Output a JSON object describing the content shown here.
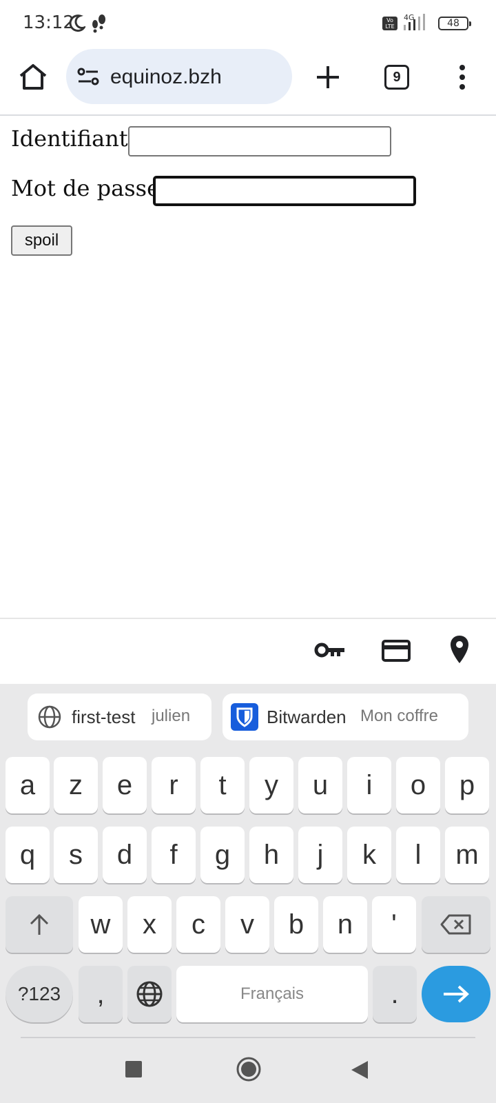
{
  "status_bar": {
    "time": "13:12",
    "network_type": "4G",
    "volte": "Vo LTE",
    "battery": "48"
  },
  "toolbar": {
    "url": "equinoz.bzh",
    "tab_count": "9"
  },
  "form": {
    "username_label": "Identifiant",
    "username_value": "",
    "password_label": "Mot de passe",
    "password_value": "",
    "submit_label": "spoil"
  },
  "autofill_suggestions": [
    {
      "main": "first-test",
      "sub": "julien",
      "icon": "globe-icon"
    },
    {
      "main": "Bitwarden",
      "sub": "Mon coffre",
      "icon": "bitwarden-icon"
    }
  ],
  "keyboard": {
    "row1": [
      "a",
      "z",
      "e",
      "r",
      "t",
      "y",
      "u",
      "i",
      "o",
      "p"
    ],
    "row2": [
      "q",
      "s",
      "d",
      "f",
      "g",
      "h",
      "j",
      "k",
      "l",
      "m"
    ],
    "row3": [
      "w",
      "x",
      "c",
      "v",
      "b",
      "n",
      "'"
    ],
    "symbols_label": "?123",
    "comma": ",",
    "space_label": "Français",
    "period": ".",
    "colors": {
      "enter": "#2b9be0",
      "background": "#e9e9ea"
    }
  }
}
